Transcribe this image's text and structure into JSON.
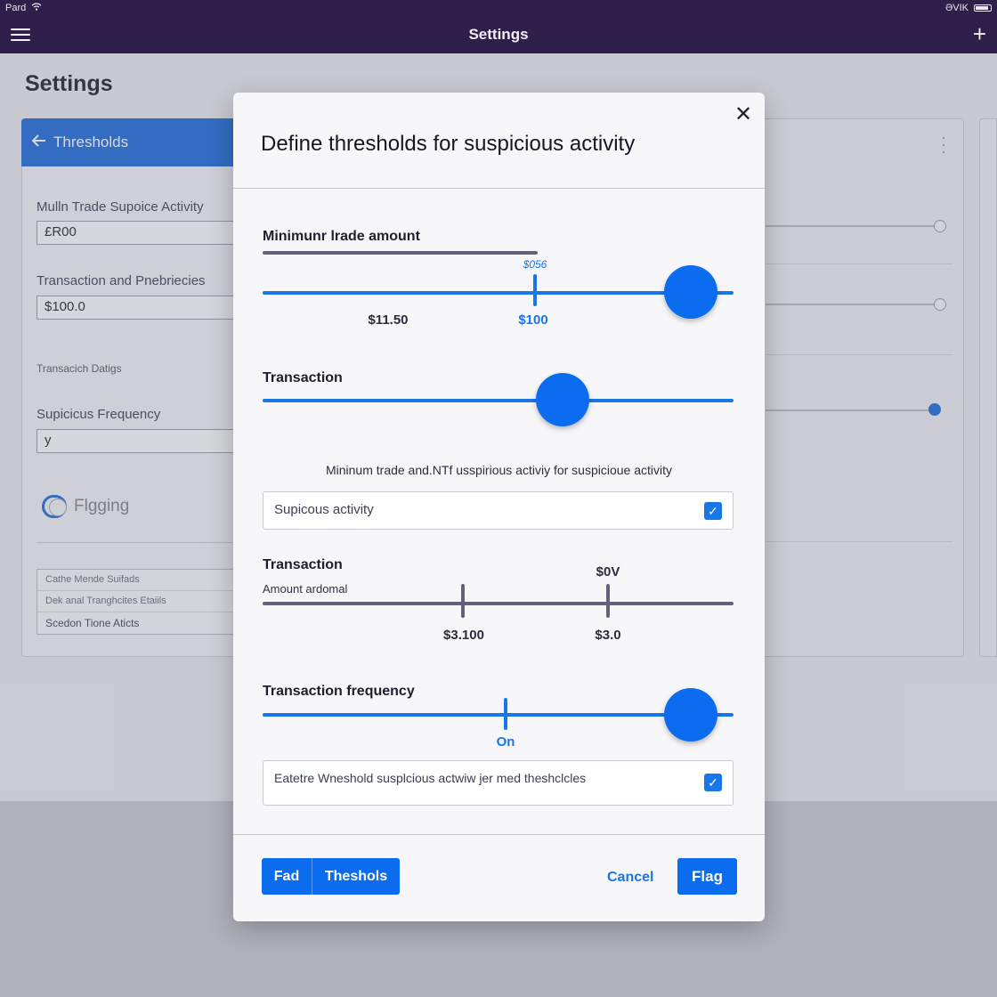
{
  "status_bar": {
    "carrier": "Pard",
    "wifi_icon": "wifi-icon",
    "right_text": "ƏVIK"
  },
  "app_bar": {
    "title": "Settings"
  },
  "background": {
    "page_title": "Settings",
    "card_header": "Thresholds",
    "field1_label": "Mulln Trade Supoice Activity",
    "field1_value": "£R00",
    "field2_label": "Transaction and Pnebriecies",
    "field2_value": "$100.0",
    "small_label": "Transacich Datigs",
    "field3_label": "Supicicus Frequency",
    "field3_value": "y",
    "toggle_label": "Flgging",
    "list_items": [
      "Cathe Mende Suifads",
      "Dek anal Tranghcites Etaiils",
      "Scedon Tione Aticts"
    ]
  },
  "modal": {
    "title": "Define thresholds for suspicious activity",
    "close_icon": "close-icon",
    "section1": {
      "label": "Minimunr lrade amount",
      "tiny_value": "$056",
      "value_left": "$11.50",
      "value_right": "$100"
    },
    "section2": {
      "label": "Transaction"
    },
    "helper_text": "Mininum trade and.NTf usspirious activiy for suspicioue activity",
    "checkbox1": {
      "label": "Supicous activity",
      "checked": true
    },
    "section3": {
      "label": "Transaction",
      "sublabel": "Amount ardomal",
      "tick_top_value": "$0V",
      "value_left": "$3.100",
      "value_right": "$3.0"
    },
    "section4": {
      "label": "Transaction frequency",
      "tick_value": "On"
    },
    "checkbox2": {
      "label": "Eatetre Wneshold susplcious actwiw jer med theshclcles",
      "checked": true
    },
    "footer": {
      "seg1": "Fad",
      "seg2": "Theshols",
      "cancel": "Cancel",
      "primary": "Flag"
    }
  },
  "colors": {
    "app_bar": "#2e1f4a",
    "accent": "#0c6cf0",
    "track_gray": "#64627a"
  }
}
